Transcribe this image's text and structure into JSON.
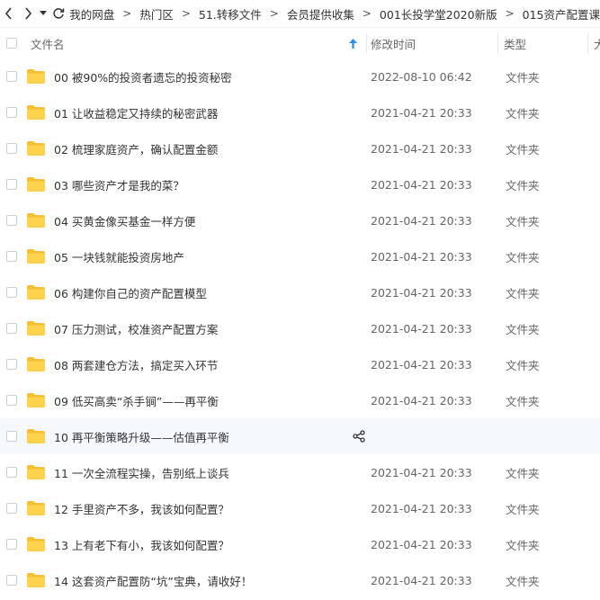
{
  "nav": {
    "back_icon": "chevron-left-icon",
    "forward_icon": "chevron-right-icon",
    "history_icon": "caret-down-icon",
    "refresh_icon": "refresh-icon"
  },
  "breadcrumbs": [
    "我的网盘",
    "热门区",
    "51.转移文件",
    "会员提供收集",
    "001长投学堂2020新版",
    "015资产配置课"
  ],
  "breadcrumb_separator": ">",
  "columns": {
    "name": "文件名",
    "sort_icon": "sort-asc-arrow-icon",
    "modified": "修改时间",
    "type": "类型",
    "size": "大"
  },
  "colors": {
    "folder": "#ffd24d",
    "folder_tab": "#f7c034",
    "sort_arrow": "#2f8cf0",
    "hover_row": "#f5f8fd"
  },
  "files": [
    {
      "name": "00 被90%的投资者遗忘的投资秘密",
      "modified": "2022-08-10 06:42",
      "type": "文件夹"
    },
    {
      "name": "01 让收益稳定又持续的秘密武器",
      "modified": "2021-04-21 20:33",
      "type": "文件夹"
    },
    {
      "name": "02 梳理家庭资产，确认配置金额",
      "modified": "2021-04-21 20:33",
      "type": "文件夹"
    },
    {
      "name": "03 哪些资产才是我的菜？",
      "modified": "2021-04-21 20:33",
      "type": "文件夹"
    },
    {
      "name": "04 买黄金像买基金一样方便",
      "modified": "2021-04-21 20:33",
      "type": "文件夹"
    },
    {
      "name": "05 一块钱就能投资房地产",
      "modified": "2021-04-21 20:33",
      "type": "文件夹"
    },
    {
      "name": "06 构建你自己的资产配置模型",
      "modified": "2021-04-21 20:33",
      "type": "文件夹"
    },
    {
      "name": "07 压力测试，校准资产配置方案",
      "modified": "2021-04-21 20:33",
      "type": "文件夹"
    },
    {
      "name": "08 两套建仓方法，搞定买入环节",
      "modified": "2021-04-21 20:33",
      "type": "文件夹"
    },
    {
      "name": "09 低买高卖“杀手锏”——再平衡",
      "modified": "2021-04-21 20:33",
      "type": "文件夹"
    },
    {
      "name": "10 再平衡策略升级——估值再平衡",
      "modified": "",
      "type": "",
      "hover": true
    },
    {
      "name": "11 一次全流程实操，告别纸上谈兵",
      "modified": "2021-04-21 20:33",
      "type": "文件夹"
    },
    {
      "name": "12 手里资产不多，我该如何配置？",
      "modified": "2021-04-21 20:33",
      "type": "文件夹"
    },
    {
      "name": "13 上有老下有小，我该如何配置？",
      "modified": "2021-04-21 20:33",
      "type": "文件夹"
    },
    {
      "name": "14 这套资产配置防“坑”宝典，请收好！",
      "modified": "2021-04-21 20:33",
      "type": "文件夹"
    }
  ],
  "row_actions": [
    "share-icon",
    "download-icon",
    "delete-icon",
    "rename-icon"
  ]
}
